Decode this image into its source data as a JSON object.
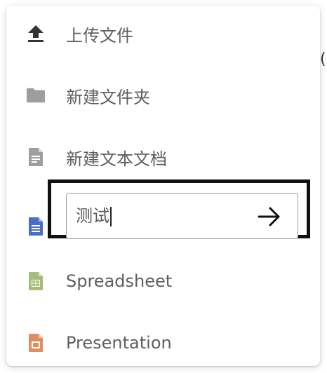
{
  "menu": {
    "items": [
      {
        "label": "上传文件",
        "icon": "upload-icon"
      },
      {
        "label": "新建文件夹",
        "icon": "folder-icon"
      },
      {
        "label": "新建文本文档",
        "icon": "text-document-icon"
      },
      {
        "label": "",
        "icon": "document-icon"
      },
      {
        "label": "Spreadsheet",
        "icon": "spreadsheet-icon"
      },
      {
        "label": "Presentation",
        "icon": "presentation-icon"
      }
    ]
  },
  "rename": {
    "value": "测试",
    "submit_icon": "arrow-right-icon"
  },
  "colors": {
    "label_text": "#5f5f5f",
    "icon_gray": "#9e9e9e",
    "upload_icon": "#333333",
    "doc_blue": "#4a6ec0",
    "sheet_green": "#a6bd77",
    "pres_orange": "#e08d62",
    "highlight_border": "#111111"
  }
}
